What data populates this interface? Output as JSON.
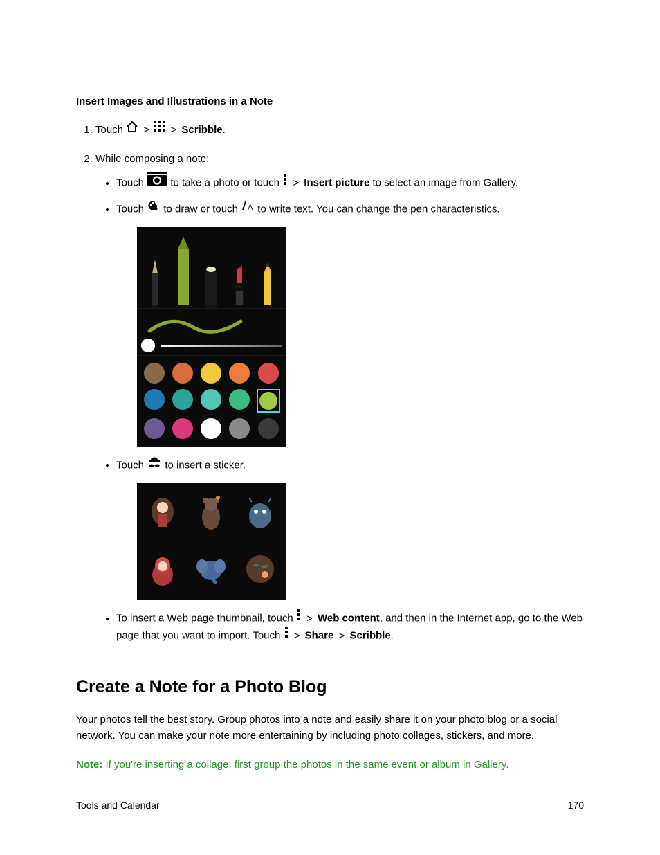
{
  "heading1": "Insert Images and Illustrations in a Note",
  "steps": {
    "s1": {
      "t_touch": "Touch",
      "t_scribble": "Scribble"
    },
    "s2": {
      "intro": "While composing a note:",
      "b1": {
        "touch": "Touch",
        "phrase": "to take a photo or touch",
        "insertPicture": "Insert picture",
        "rest": "to select an image from Gallery."
      },
      "b2": {
        "touch": "Touch",
        "mid": "to draw or touch",
        "rest": "to write text. You can change the pen characteristics."
      },
      "b3": {
        "touch": "Touch",
        "rest": "to insert a sticker."
      },
      "b4": {
        "lead": "To insert a Web page thumbnail, touch",
        "web": "Web content",
        "mid": ", and then in the Internet app, go to the Web page that you want to import. Touch",
        "share": "Share",
        "scribble": "Scribble"
      }
    }
  },
  "gt": ">",
  "period": ".",
  "swatches": [
    "#8a6a4a",
    "#d96d3a",
    "#f2c93b",
    "#ee7b3a",
    "#d94a4a",
    "#1f7bb3",
    "#2ea39c",
    "#4ec7b5",
    "#3bba84",
    "#a3c94b",
    "#6e5a95",
    "#d93a7b",
    "#ffffff",
    "#8a8a8a",
    "#3a3a3a"
  ],
  "selectedSwatchIndex": 9,
  "heading2": "Create a Note for a Photo Blog",
  "blogPara": "Your photos tell the best story. Group photos into a note and easily share it on your photo blog or a social network. You can make your note more entertaining by including photo collages, stickers, and more.",
  "note": {
    "label": "Note:",
    "text": " If you're inserting a collage, first group the photos in the same event or album in Gallery."
  },
  "footer": {
    "left": "Tools and Calendar",
    "right": "170"
  }
}
